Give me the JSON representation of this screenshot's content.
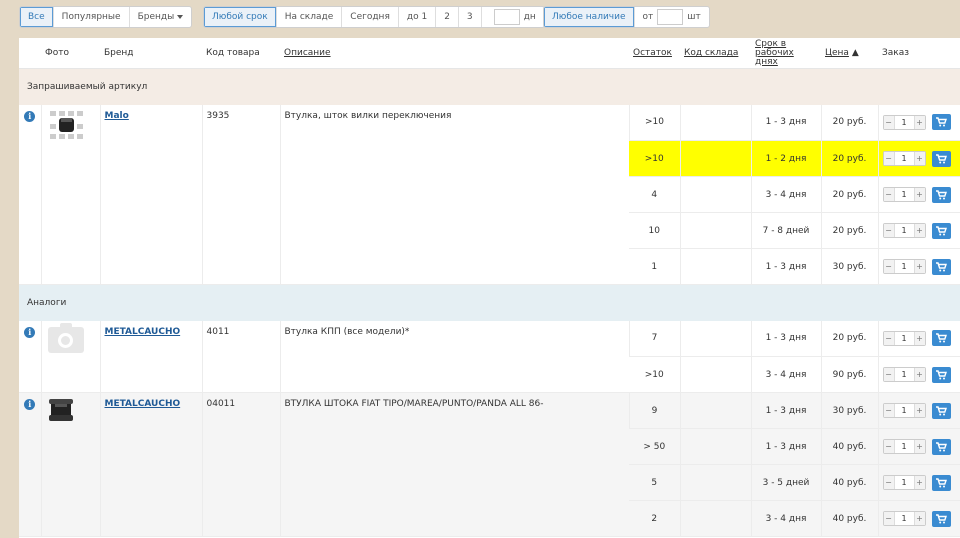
{
  "filters": {
    "group1": [
      "Все",
      "Популярные",
      "Бренды"
    ],
    "group2": [
      "Любой срок",
      "На складе",
      "Сегодня",
      "до 1",
      "2",
      "3"
    ],
    "days_unit": "дн",
    "group3_any": "Любое наличие",
    "from_label": "от",
    "qty_unit": "шт"
  },
  "table": {
    "headers": {
      "photo": "Фото",
      "brand": "Бренд",
      "code": "Код товара",
      "desc": "Описание",
      "stock": "Остаток",
      "warehouse": "Код склада",
      "term_line1": "Срок в",
      "term_line2": "рабочих днях",
      "price": "Цена",
      "price_sort": "▲",
      "order": "Заказ"
    },
    "section_requested": "Запрашиваемый артикул",
    "section_analogs": "Аналоги",
    "items": [
      {
        "brand": "Malo",
        "code": "3935",
        "desc": "Втулка, шток вилки переключения",
        "rows": [
          {
            "stock": ">10",
            "term": "1 - 3 дня",
            "price": "20 руб.",
            "qty": "1"
          },
          {
            "stock": ">10",
            "term": "1 - 2 дня",
            "price": "20 руб.",
            "qty": "1"
          },
          {
            "stock": "4",
            "term": "3 - 4 дня",
            "price": "20 руб.",
            "qty": "1"
          },
          {
            "stock": "10",
            "term": "7 - 8 дней",
            "price": "20 руб.",
            "qty": "1"
          },
          {
            "stock": "1",
            "term": "1 - 3 дня",
            "price": "30 руб.",
            "qty": "1"
          }
        ]
      },
      {
        "brand": "METALCAUCHO",
        "code": "4011",
        "desc": "Втулка КПП (все модели)*",
        "rows": [
          {
            "stock": "7",
            "term": "1 - 3 дня",
            "price": "20 руб.",
            "qty": "1"
          },
          {
            "stock": ">10",
            "term": "3 - 4 дня",
            "price": "90 руб.",
            "qty": "1"
          }
        ]
      },
      {
        "brand": "METALCAUCHO",
        "code": "04011",
        "desc": "ВТУЛКА ШТОКА FIAT TIPO/MAREA/PUNTO/PANDA ALL 86-",
        "rows": [
          {
            "stock": "9",
            "term": "1 - 3 дня",
            "price": "30 руб.",
            "qty": "1"
          },
          {
            "stock": "> 50",
            "term": "1 - 3 дня",
            "price": "40 руб.",
            "qty": "1"
          },
          {
            "stock": "5",
            "term": "3 - 5 дней",
            "price": "40 руб.",
            "qty": "1"
          },
          {
            "stock": "2",
            "term": "3 - 4 дня",
            "price": "40 руб.",
            "qty": "1"
          }
        ]
      }
    ]
  },
  "colors": {
    "highlight": "#ffff00",
    "accent": "#337ab7",
    "page_bg": "#e4d9c6"
  },
  "icons": [
    "info-icon",
    "cart-icon",
    "camera-placeholder-icon",
    "caret-down-icon"
  ]
}
